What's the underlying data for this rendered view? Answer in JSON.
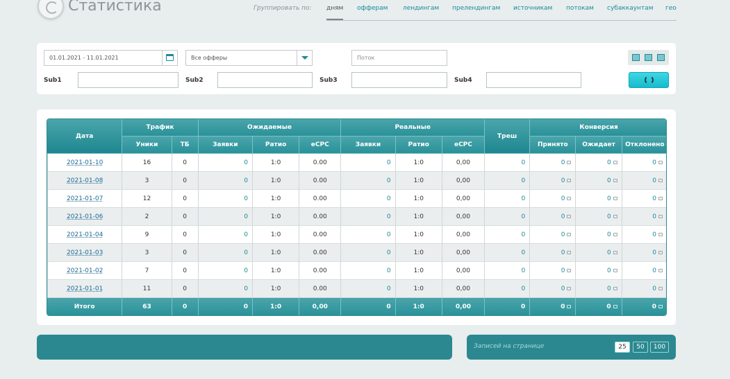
{
  "header": {
    "title": "Статистика",
    "group_label": "Группировать по:",
    "group_tabs": [
      "дням",
      "офферам",
      "лендингам",
      "прелендингам",
      "источникам",
      "потокам",
      "субаккаунтам",
      "гео"
    ]
  },
  "filters": {
    "date_range": "01.01.2021 - 11.01.2021",
    "offer_select": "Все офферы",
    "stream_placeholder": "Поток",
    "sub1": "Sub1",
    "sub2": "Sub2",
    "sub3": "Sub3",
    "sub4": "Sub4"
  },
  "table": {
    "group_headers": {
      "date": "Дата",
      "traffic": "Трафик",
      "expected": "Ожидаемые",
      "real": "Реальные",
      "trash": "Треш",
      "conversion": "Конверсия"
    },
    "sub_headers": {
      "uniques": "Уники",
      "tb": "ТБ",
      "exp_leads": "Заявки",
      "exp_ratio": "Ратио",
      "exp_ecpc": "eCPC",
      "real_leads": "Заявки",
      "real_ratio": "Ратио",
      "real_ecpc": "eCPC",
      "accepted": "Принято",
      "waiting": "Ожидает",
      "rejected": "Отклонено"
    },
    "rows": [
      {
        "date": "2021-01-10",
        "uniques": "16",
        "tb": "0",
        "exp_leads": "0",
        "exp_ratio": "1:0",
        "exp_ecpc": "0.00",
        "real_leads": "0",
        "real_ratio": "1:0",
        "real_ecpc": "0,00",
        "trash": "0",
        "accepted": "0",
        "waiting": "0",
        "rejected": "0"
      },
      {
        "date": "2021-01-08",
        "uniques": "3",
        "tb": "0",
        "exp_leads": "0",
        "exp_ratio": "1:0",
        "exp_ecpc": "0.00",
        "real_leads": "0",
        "real_ratio": "1:0",
        "real_ecpc": "0,00",
        "trash": "0",
        "accepted": "0",
        "waiting": "0",
        "rejected": "0"
      },
      {
        "date": "2021-01-07",
        "uniques": "12",
        "tb": "0",
        "exp_leads": "0",
        "exp_ratio": "1:0",
        "exp_ecpc": "0.00",
        "real_leads": "0",
        "real_ratio": "1:0",
        "real_ecpc": "0,00",
        "trash": "0",
        "accepted": "0",
        "waiting": "0",
        "rejected": "0"
      },
      {
        "date": "2021-01-06",
        "uniques": "2",
        "tb": "0",
        "exp_leads": "0",
        "exp_ratio": "1:0",
        "exp_ecpc": "0.00",
        "real_leads": "0",
        "real_ratio": "1:0",
        "real_ecpc": "0,00",
        "trash": "0",
        "accepted": "0",
        "waiting": "0",
        "rejected": "0"
      },
      {
        "date": "2021-01-04",
        "uniques": "9",
        "tb": "0",
        "exp_leads": "0",
        "exp_ratio": "1:0",
        "exp_ecpc": "0.00",
        "real_leads": "0",
        "real_ratio": "1:0",
        "real_ecpc": "0,00",
        "trash": "0",
        "accepted": "0",
        "waiting": "0",
        "rejected": "0"
      },
      {
        "date": "2021-01-03",
        "uniques": "3",
        "tb": "0",
        "exp_leads": "0",
        "exp_ratio": "1:0",
        "exp_ecpc": "0.00",
        "real_leads": "0",
        "real_ratio": "1:0",
        "real_ecpc": "0,00",
        "trash": "0",
        "accepted": "0",
        "waiting": "0",
        "rejected": "0"
      },
      {
        "date": "2021-01-02",
        "uniques": "7",
        "tb": "0",
        "exp_leads": "0",
        "exp_ratio": "1:0",
        "exp_ecpc": "0.00",
        "real_leads": "0",
        "real_ratio": "1:0",
        "real_ecpc": "0,00",
        "trash": "0",
        "accepted": "0",
        "waiting": "0",
        "rejected": "0"
      },
      {
        "date": "2021-01-01",
        "uniques": "11",
        "tb": "0",
        "exp_leads": "0",
        "exp_ratio": "1:0",
        "exp_ecpc": "0.00",
        "real_leads": "0",
        "real_ratio": "1:0",
        "real_ecpc": "0,00",
        "trash": "0",
        "accepted": "0",
        "waiting": "0",
        "rejected": "0"
      }
    ],
    "total": {
      "label": "Итого",
      "uniques": "63",
      "tb": "0",
      "exp_leads": "0",
      "exp_ratio": "1:0",
      "exp_ecpc": "0,00",
      "real_leads": "0",
      "real_ratio": "1:0",
      "real_ecpc": "0,00",
      "trash": "0",
      "accepted": "0",
      "waiting": "0",
      "rejected": "0"
    }
  },
  "pager": {
    "label": "Записей на странице",
    "options": [
      "25",
      "50",
      "100"
    ]
  },
  "icons": {
    "calendar": "calendar-icon",
    "dropdown": "chevron-down-icon",
    "refresh": "refresh-icon",
    "comment": "comment-icon",
    "view": "view-toggle-icon"
  },
  "colors": {
    "accent": "#1c8a9a",
    "header_teal": "#2a9199",
    "bar_teal": "#2c8890",
    "refresh_cyan": "#16bccc",
    "background": "#e8edee"
  }
}
